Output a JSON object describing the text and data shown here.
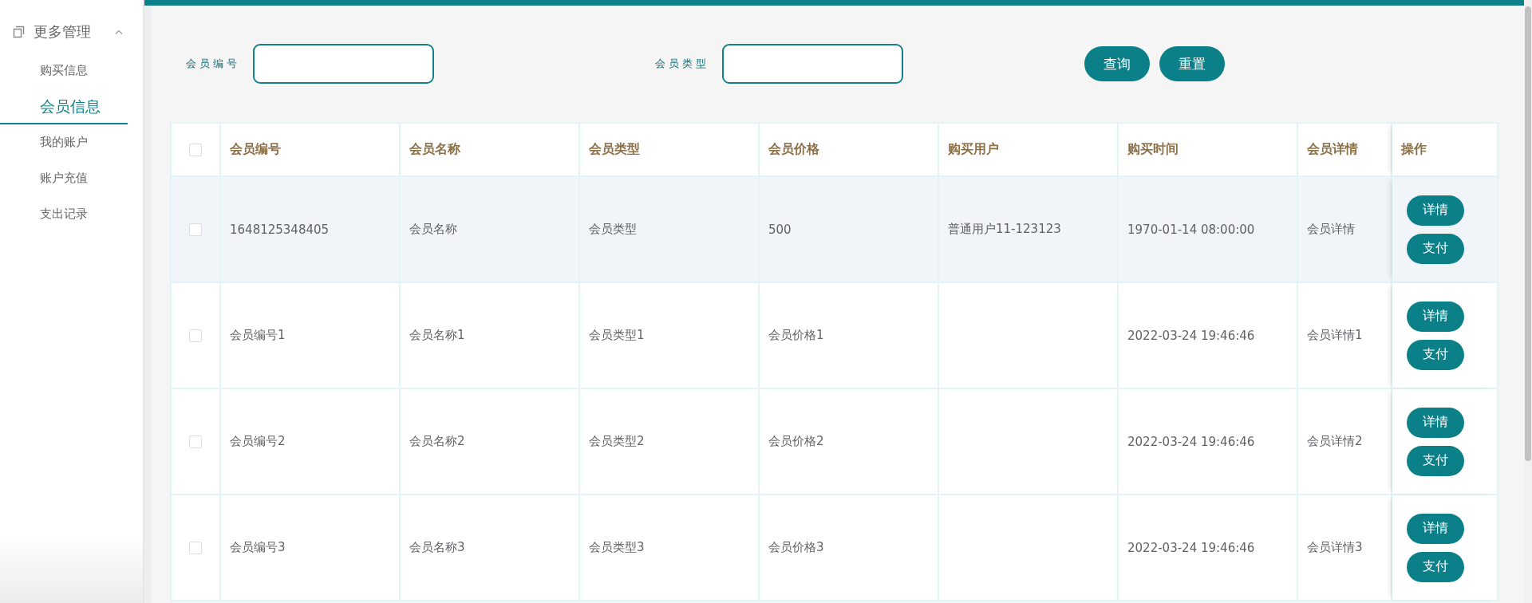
{
  "sidebar": {
    "group": {
      "label": "更多管理",
      "expanded": true
    },
    "items": [
      {
        "label": "购买信息",
        "selected": false
      },
      {
        "label": "会员信息",
        "selected": true
      },
      {
        "label": "我的账户",
        "selected": false
      },
      {
        "label": "账户充值",
        "selected": false
      },
      {
        "label": "支出记录",
        "selected": false
      }
    ]
  },
  "search": {
    "fields": [
      {
        "label": "会员编号"
      },
      {
        "label": "会员类型"
      }
    ],
    "buttons": [
      "查询",
      "重置"
    ]
  },
  "table": {
    "select_all": {
      "checked": false
    },
    "columns": [
      "会员编号",
      "会员名称",
      "会员类型",
      "会员价格",
      "购买用户",
      "购买时间",
      "会员详情",
      "操作"
    ],
    "rows": [
      {
        "checked": false,
        "hovered": true,
        "cells": [
          "1648125348405",
          "会员名称",
          "会员类型",
          "500",
          "普通用户11-123123",
          "1970-01-14 08:00:00",
          "会员详情"
        ],
        "actions": [
          "详情",
          "支付"
        ]
      },
      {
        "checked": false,
        "hovered": false,
        "cells": [
          "会员编号1",
          "会员名称1",
          "会员类型1",
          "会员价格1",
          "",
          "2022-03-24 19:46:46",
          "会员详情1"
        ],
        "actions": [
          "详情",
          "支付"
        ]
      },
      {
        "checked": false,
        "hovered": false,
        "cells": [
          "会员编号2",
          "会员名称2",
          "会员类型2",
          "会员价格2",
          "",
          "2022-03-24 19:46:46",
          "会员详情2"
        ],
        "actions": [
          "详情",
          "支付"
        ]
      },
      {
        "checked": false,
        "hovered": false,
        "cells": [
          "会员编号3",
          "会员名称3",
          "会员类型3",
          "会员价格3",
          "",
          "2022-03-24 19:46:46",
          "会员详情3"
        ],
        "actions": [
          "详情",
          "支付"
        ]
      }
    ]
  }
}
